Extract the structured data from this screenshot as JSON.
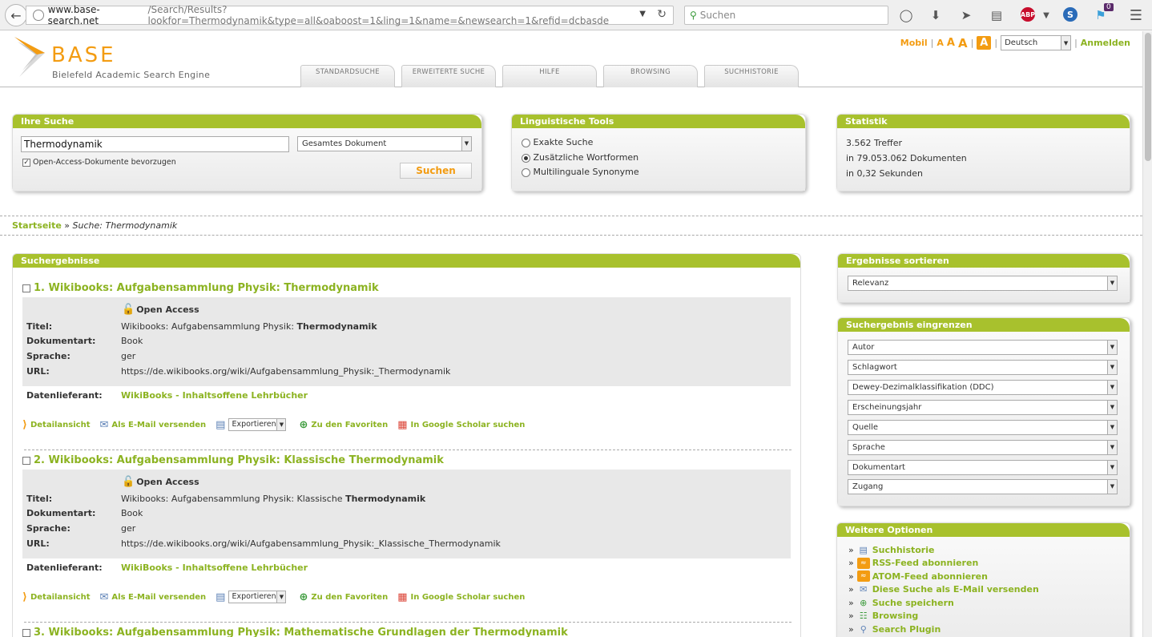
{
  "browser": {
    "url_host": "www.base-search.net",
    "url_path": "/Search/Results?lookfor=Thermodynamik&type=all&oaboost=1&ling=1&name=&newsearch=1&refid=dcbasde",
    "search_placeholder": "Suchen",
    "notification_count": "0"
  },
  "header": {
    "logo": "BASE",
    "logo_sub": "Bielefeld Academic Search Engine",
    "mobil": "Mobil",
    "font_small": "A",
    "font_medium": "A",
    "font_large": "A",
    "font_active": "A",
    "language": "Deutsch",
    "login": "Anmelden",
    "tabs": [
      {
        "label": "STANDARDSUCHE"
      },
      {
        "label": "ERWEITERTE SUCHE"
      },
      {
        "label": "HILFE"
      },
      {
        "label": "BROWSING"
      },
      {
        "label": "SUCHHISTORIE"
      }
    ]
  },
  "search_panel": {
    "title": "Ihre Suche",
    "query": "Thermodynamik",
    "scope": "Gesamtes Dokument",
    "oa_checkbox_label": "Open-Access-Dokumente bevorzugen",
    "submit": "Suchen"
  },
  "ling_panel": {
    "title": "Linguistische Tools",
    "options": [
      "Exakte Suche",
      "Zusätzliche Wortformen",
      "Multilinguale Synonyme"
    ]
  },
  "stats_panel": {
    "title": "Statistik",
    "hits": "3.562 Treffer",
    "docs": "in 79.053.062 Dokumenten",
    "time": "in 0,32 Sekunden"
  },
  "breadcrumb": {
    "home": "Startseite",
    "sep": "»",
    "current": "Suche: Thermodynamik"
  },
  "results": {
    "title": "Suchergebnisse",
    "labels": {
      "title": "Titel:",
      "doctype": "Dokumentart:",
      "language": "Sprache:",
      "url": "URL:",
      "provider": "Datenlieferant:",
      "open_access": "Open Access"
    },
    "actions": {
      "detail": "Detailansicht",
      "email": "Als E-Mail versenden",
      "export": "Exportieren",
      "favorites": "Zu den Favoriten",
      "scholar": "In Google Scholar suchen"
    },
    "items": [
      {
        "heading": "1. Wikibooks: Aufgabensammlung Physik: Thermodynamik",
        "title_prefix": "Wikibooks: Aufgabensammlung Physik: ",
        "title_bold": "Thermodynamik",
        "doctype": "Book",
        "language": "ger",
        "url": "https://de.wikibooks.org/wiki/Aufgabensammlung_Physik:_Thermodynamik",
        "provider": "WikiBooks - Inhaltsoffene Lehrbücher"
      },
      {
        "heading": "2. Wikibooks: Aufgabensammlung Physik: Klassische Thermodynamik",
        "title_prefix": "Wikibooks: Aufgabensammlung Physik: Klassische ",
        "title_bold": "Thermodynamik",
        "doctype": "Book",
        "language": "ger",
        "url": "https://de.wikibooks.org/wiki/Aufgabensammlung_Physik:_Klassische_Thermodynamik",
        "provider": "WikiBooks - Inhaltsoffene Lehrbücher"
      },
      {
        "heading": "3. Wikibooks: Aufgabensammlung Physik: Mathematische Grundlagen der Thermodynamik"
      }
    ]
  },
  "sort_panel": {
    "title": "Ergebnisse sortieren",
    "value": "Relevanz"
  },
  "filter_panel": {
    "title": "Suchergebnis eingrenzen",
    "filters": [
      "Autor",
      "Schlagwort",
      "Dewey-Dezimalklassifikation (DDC)",
      "Erscheinungsjahr",
      "Quelle",
      "Sprache",
      "Dokumentart",
      "Zugang"
    ]
  },
  "options_panel": {
    "title": "Weitere Optionen",
    "bullet": "»",
    "items": [
      {
        "label": "Suchhistorie",
        "icon": "history-icon"
      },
      {
        "label": "RSS-Feed abonnieren",
        "icon": "rss-icon"
      },
      {
        "label": "ATOM-Feed abonnieren",
        "icon": "atom-icon"
      },
      {
        "label": "Diese Suche als E-Mail versenden",
        "icon": "mail-icon"
      },
      {
        "label": "Suche speichern",
        "icon": "save-icon"
      },
      {
        "label": "Browsing",
        "icon": "sitemap-icon"
      },
      {
        "label": "Search Plugin",
        "icon": "plugin-icon"
      }
    ]
  },
  "colors": {
    "accent_green": "#a8c12d",
    "link_green": "#8cb321",
    "brand_orange": "#f39c12"
  }
}
